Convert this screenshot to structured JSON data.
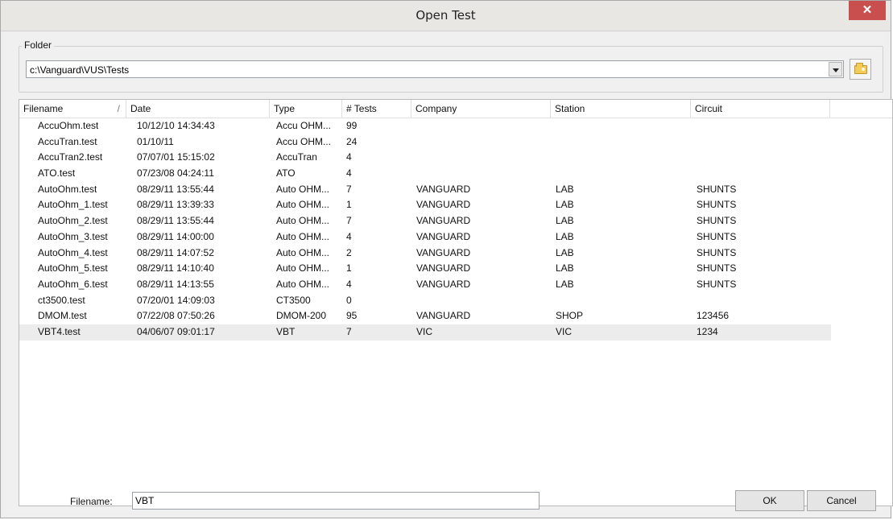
{
  "window": {
    "title": "Open Test",
    "close_glyph": "✕"
  },
  "folder": {
    "legend": "Folder",
    "path": "c:\\Vanguard\\VUS\\Tests",
    "browse_icon": "folder-icon"
  },
  "list": {
    "columns": [
      "Filename",
      "Date",
      "Type",
      "# Tests",
      "Company",
      "Station",
      "Circuit"
    ],
    "sort_indicator": "/",
    "rows": [
      [
        "AccuOhm.test",
        "10/12/10 14:34:43",
        "Accu OHM...",
        "99",
        "",
        "",
        ""
      ],
      [
        "AccuTran.test",
        "01/10/11",
        "Accu OHM...",
        "24",
        "",
        "",
        ""
      ],
      [
        "AccuTran2.test",
        "07/07/01 15:15:02",
        "AccuTran",
        "4",
        "",
        "",
        ""
      ],
      [
        "ATO.test",
        "07/23/08 04:24:11",
        "ATO",
        "4",
        "",
        "",
        ""
      ],
      [
        "AutoOhm.test",
        "08/29/11 13:55:44",
        "Auto OHM...",
        "7",
        "VANGUARD",
        "LAB",
        "SHUNTS"
      ],
      [
        "AutoOhm_1.test",
        "08/29/11 13:39:33",
        "Auto OHM...",
        "1",
        "VANGUARD",
        "LAB",
        "SHUNTS"
      ],
      [
        "AutoOhm_2.test",
        "08/29/11 13:55:44",
        "Auto OHM...",
        "7",
        "VANGUARD",
        "LAB",
        "SHUNTS"
      ],
      [
        "AutoOhm_3.test",
        "08/29/11 14:00:00",
        "Auto OHM...",
        "4",
        "VANGUARD",
        "LAB",
        "SHUNTS"
      ],
      [
        "AutoOhm_4.test",
        "08/29/11 14:07:52",
        "Auto OHM...",
        "2",
        "VANGUARD",
        "LAB",
        "SHUNTS"
      ],
      [
        "AutoOhm_5.test",
        "08/29/11 14:10:40",
        "Auto OHM...",
        "1",
        "VANGUARD",
        "LAB",
        "SHUNTS"
      ],
      [
        "AutoOhm_6.test",
        "08/29/11 14:13:55",
        "Auto OHM...",
        "4",
        "VANGUARD",
        "LAB",
        "SHUNTS"
      ],
      [
        "ct3500.test",
        "07/20/01 14:09:03",
        "CT3500",
        "0",
        "",
        "",
        ""
      ],
      [
        "DMOM.test",
        "07/22/08 07:50:26",
        "DMOM-200",
        "95",
        "VANGUARD",
        "SHOP",
        "123456"
      ],
      [
        "VBT4.test",
        "04/06/07 09:01:17",
        "VBT",
        "7",
        "VIC",
        "VIC",
        "1234"
      ]
    ],
    "selected_row": 13
  },
  "bottom": {
    "filename_label": "Filename:",
    "filename_value": "VBT",
    "ok_label": "OK",
    "cancel_label": "Cancel"
  },
  "colors": {
    "close_button": "#c94f4f",
    "selected_row": "#ececec",
    "folder_icon": "#f3cb58"
  }
}
